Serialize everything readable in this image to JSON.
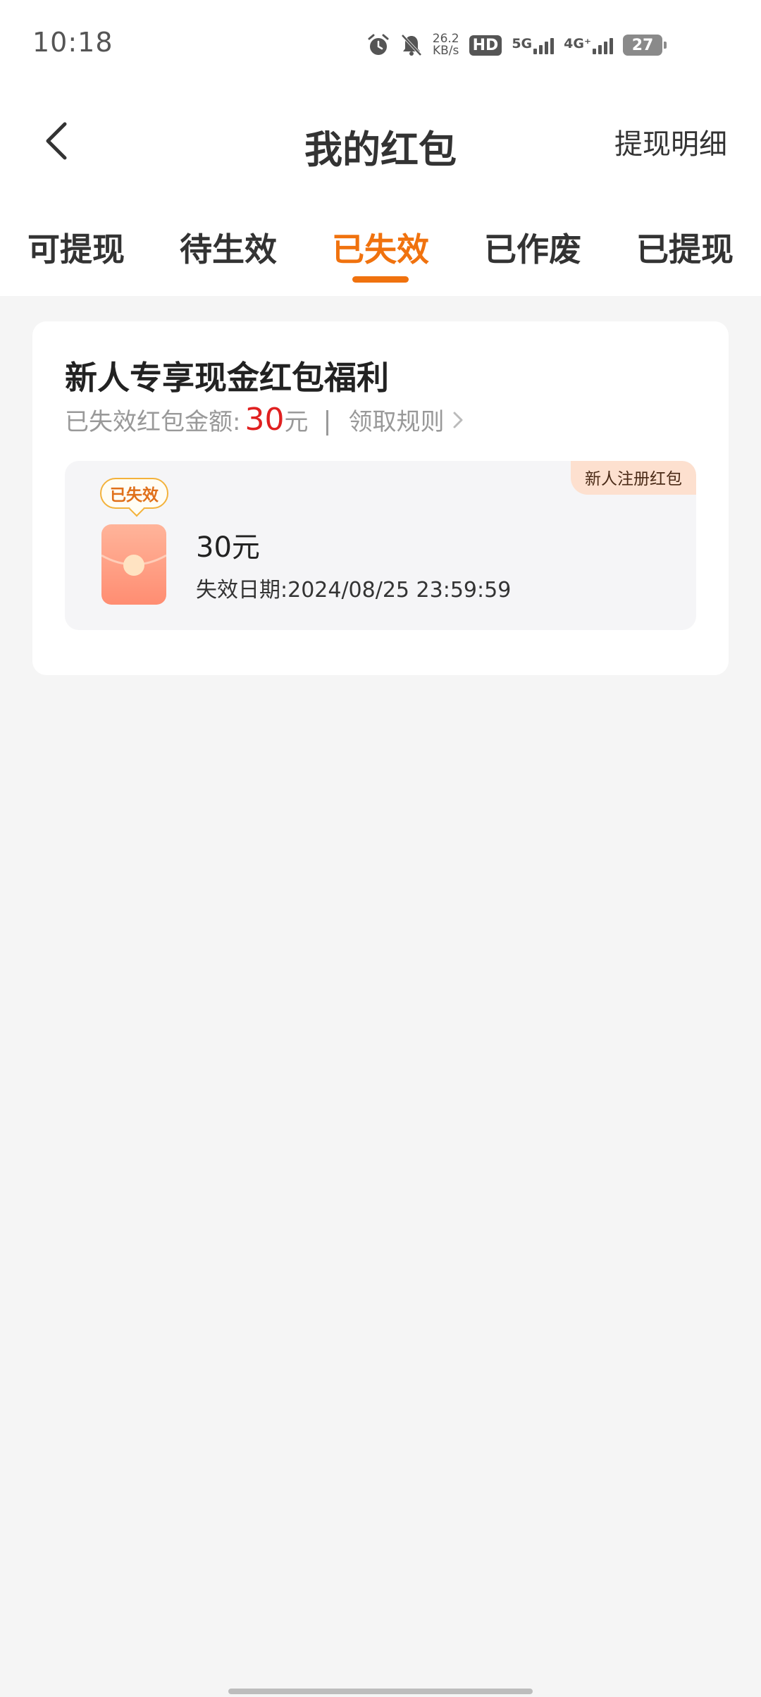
{
  "status_bar": {
    "time": "10:18",
    "net_speed_value": "26.2",
    "net_speed_unit": "KB/s",
    "hd_label": "HD",
    "sim1_label": "5G",
    "sim2_label": "4G⁺",
    "battery": "27",
    "icons": [
      "alarm-icon",
      "mute-icon",
      "hd-icon",
      "signal-5g-icon",
      "signal-4g-icon",
      "battery-icon"
    ]
  },
  "header": {
    "title": "我的红包",
    "right_link": "提现明细",
    "back_icon": "chevron-left-icon"
  },
  "tabs": {
    "items": [
      {
        "label": "可提现"
      },
      {
        "label": "待生效"
      },
      {
        "label": "已失效"
      },
      {
        "label": "已作废"
      },
      {
        "label": "已提现"
      }
    ],
    "active_index": 2,
    "active_color": "#f0720e"
  },
  "card": {
    "title": "新人专享现金红包福利",
    "summary_label": "已失效红包金额:",
    "summary_amount": "30",
    "summary_unit": "元",
    "rules_label": "领取规则",
    "item": {
      "corner_tag": "新人注册红包",
      "status_tag": "已失效",
      "amount": "30元",
      "expire_text": "失效日期:2024/08/25 23:59:59",
      "icon": "red-envelope-icon"
    }
  },
  "colors": {
    "accent": "#f0720e",
    "amount_red": "#e02020",
    "background": "#f5f5f5"
  }
}
